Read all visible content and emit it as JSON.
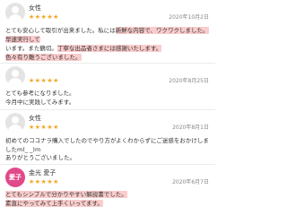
{
  "reviews": [
    {
      "name": "女性",
      "stars": "★★★★★",
      "date": "2020年10月2日",
      "lines": [
        {
          "plain": "とても安心して取引が出来ました。私には",
          "hl": "新鮮な内容で、ワクワクしました。"
        },
        {
          "plain": "",
          "hl": "早速実行して"
        },
        {
          "plain": "います。また鶴切。",
          "hl": "丁寧な出品者さまには感謝いたします。"
        },
        {
          "plain": "",
          "hl": "色々有り難うございました。"
        }
      ]
    },
    {
      "name": "",
      "stars": "★★★★★",
      "date": "2020年8月25日",
      "lines": [
        {
          "plain": "とても参考になりました。",
          "hl": ""
        },
        {
          "plain": "今月中に実践してみます。",
          "hl": ""
        }
      ]
    },
    {
      "name": "女性",
      "stars": "★★★★★",
      "date": "2020年8月1日",
      "lines": [
        {
          "plain": "初めてのココナラ購入でしたのでやり方がよくわからずにご迷惑をおかけしましたm(_ _)m",
          "hl": ""
        },
        {
          "plain": "ありがとうございました。",
          "hl": ""
        }
      ]
    },
    {
      "name": "金光 愛子",
      "avatar_text": "愛子",
      "stars": "★★★★★",
      "date": "2020年6月7日",
      "lines": [
        {
          "plain": "",
          "hl": "とてもシンプルで分かりやすい解説書でした。"
        },
        {
          "plain": "",
          "hl": "素直にやってみて上手くいってます。"
        }
      ]
    }
  ]
}
